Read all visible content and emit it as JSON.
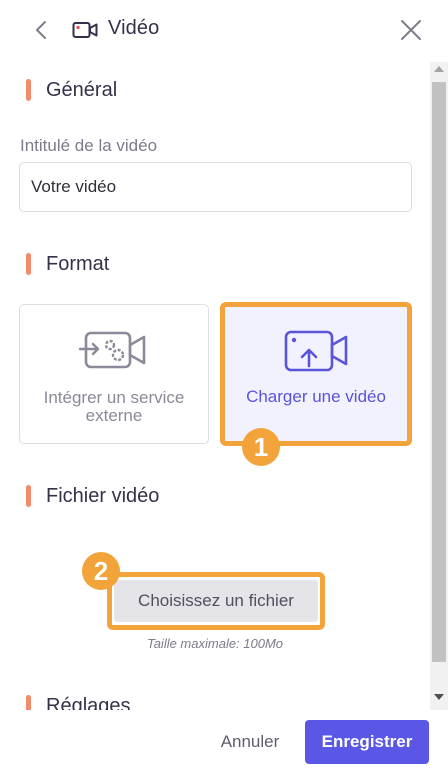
{
  "header": {
    "title": "Vidéo",
    "back_icon": "chevron-left-icon",
    "title_icon": "video-camera-icon",
    "close_icon": "close-icon"
  },
  "sections": {
    "general": "Général",
    "format": "Format",
    "file": "Fichier vidéo",
    "settings": "Réglages"
  },
  "general": {
    "field_label": "Intitulé de la vidéo",
    "field_value": "Votre vidéo"
  },
  "format": {
    "options": [
      {
        "label": "Intégrer un service externe",
        "icon": "video-settings-icon",
        "selected": false
      },
      {
        "label": "Charger une vidéo",
        "icon": "video-upload-icon",
        "selected": true
      }
    ]
  },
  "file": {
    "button_label": "Choisissez un fichier",
    "max_size": "Taille maximale: 100Mo"
  },
  "annotations": {
    "step1": "1",
    "step2": "2"
  },
  "footer": {
    "cancel_label": "Annuler",
    "save_label": "Enregistrer"
  },
  "colors": {
    "accent": "#5b57e6",
    "section_marker": "#f28a6d",
    "highlight": "#f2a33a",
    "selected_card_bg": "#f2f2ff"
  }
}
